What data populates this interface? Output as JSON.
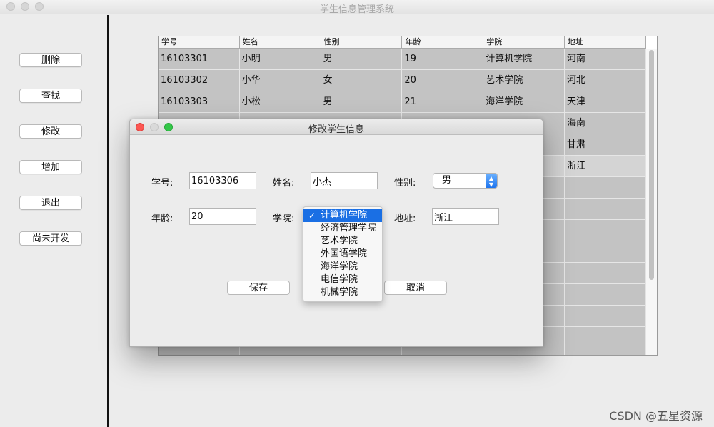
{
  "window": {
    "title": "学生信息管理系统"
  },
  "sidebar": {
    "buttons": [
      {
        "label": "删除"
      },
      {
        "label": "查找"
      },
      {
        "label": "修改"
      },
      {
        "label": "增加"
      },
      {
        "label": "退出"
      },
      {
        "label": "尚未开发"
      }
    ]
  },
  "table": {
    "columns": [
      "学号",
      "姓名",
      "性别",
      "年龄",
      "学院",
      "地址"
    ],
    "rows": [
      [
        "16103301",
        "小明",
        "男",
        "19",
        "计算机学院",
        "河南"
      ],
      [
        "16103302",
        "小华",
        "女",
        "20",
        "艺术学院",
        "河北"
      ],
      [
        "16103303",
        "小松",
        "男",
        "21",
        "海洋学院",
        "天津"
      ],
      [
        "",
        "",
        "",
        "",
        "",
        "海南"
      ],
      [
        "",
        "",
        "",
        "",
        "",
        "甘肃"
      ],
      [
        "",
        "",
        "",
        "",
        "",
        "浙江"
      ],
      [
        "",
        "",
        "",
        "",
        "",
        ""
      ],
      [
        "",
        "",
        "",
        "",
        "",
        ""
      ],
      [
        "",
        "",
        "",
        "",
        "",
        ""
      ],
      [
        "",
        "",
        "",
        "",
        "",
        ""
      ],
      [
        "",
        "",
        "",
        "",
        "",
        ""
      ],
      [
        "",
        "",
        "",
        "",
        "",
        ""
      ],
      [
        "",
        "",
        "",
        "",
        "",
        ""
      ],
      [
        "",
        "",
        "",
        "",
        "",
        ""
      ],
      [
        "",
        "",
        "",
        "",
        "",
        ""
      ]
    ]
  },
  "dialog": {
    "title": "修改学生信息",
    "id_label": "学号:",
    "id_value": "16103306",
    "name_label": "姓名:",
    "name_value": "小杰",
    "gender_label": "性别:",
    "gender_value": "男",
    "age_label": "年龄:",
    "age_value": "20",
    "college_label": "学院:",
    "address_label": "地址:",
    "address_value": "浙江",
    "save_label": "保存",
    "cancel_label": "取消"
  },
  "college_dropdown": {
    "check": "✓",
    "options": [
      "计算机学院",
      "经济管理学院",
      "艺术学院",
      "外国语学院",
      "海洋学院",
      "电信学院",
      "机械学院"
    ],
    "selected_index": 0
  },
  "watermark": "CSDN @五星资源"
}
